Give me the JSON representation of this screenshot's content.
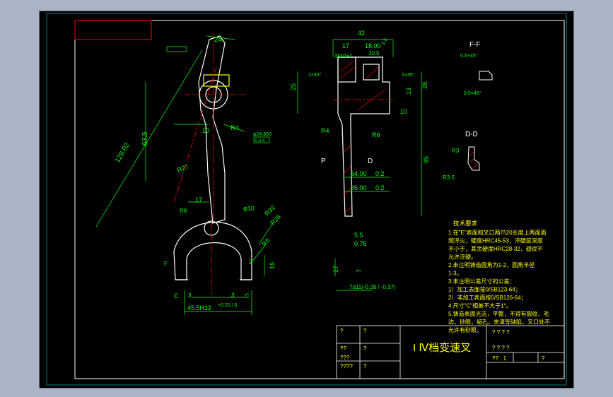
{
  "title_block": {
    "part_name": "I Ⅳ档变速叉",
    "scale_text": "? ? ? ?",
    "sheet_text": "?? : 1",
    "q": "?",
    "q2": "??",
    "q3": "???",
    "q4": "????"
  },
  "tech_req": {
    "heading": "技术要求",
    "lines": [
      "1.在\"E\"表面和叉口两爪20长度上两面面",
      "频淬火，硬度HRC45-53，淬硬层深度",
      "不小于，其余硬度HRC28-32，翅纹不",
      "允许淬硬。",
      "2.未注明铸造圆角为1-2，圆角半径",
      "1-3。",
      "3.未注明公差尺寸的公差：",
      "  1）加工表面按0/SB123-64；",
      "  2）非加工表面按0/SB126-64；",
      "4.尺寸\"C\"相差不大于1°。",
      "5.铸造表面光洁，平整，不得有裂纹，毛",
      "  边，砂眼，缩孔，夹渣等缺陷，叉口处不",
      "  允许有砂眼。"
    ]
  },
  "section_labels": {
    "ff": "F-F",
    "dd": "D-D",
    "p": "P",
    "d": "D"
  },
  "dims_left": {
    "d24": "24",
    "d128": "128.02",
    "d63": "63.5",
    "d10a": "10",
    "d17": "17",
    "r4": "R4",
    "r27": "R27",
    "phi10": "φ10",
    "r32": "R32",
    "r26": "R26",
    "r6": "R6",
    "d16": "16",
    "d2": "2",
    "c1": "C",
    "c2": "C",
    "d3a": "3",
    "d3b": "3",
    "d45": "45.5H12",
    "tol": "+0.25 / 0",
    "phi24": "φ24.800",
    "box": "0.4 A",
    "r8": "R8",
    "f": "F"
  },
  "dims_right": {
    "d42": "42",
    "d17": "17",
    "d1800": "18.00",
    "d105": "10.5",
    "d15": "1.5",
    "m10": "M10×1",
    "d25": "25",
    "d13": "13",
    "d28": "28",
    "d10": "10",
    "d95": "95",
    "d34": "34.00",
    "d02a": "0.2",
    "d35": "35.00",
    "d02b": "0.2",
    "d55": "5.5",
    "d075": "0.75",
    "d27": "27",
    "d7": "7",
    "tol7": "7d11(-0.28 / -0.37)",
    "r4": "R4",
    "r6": "R6",
    "ch1": "1×45°",
    "ch2": "1×45°",
    "r3": "R3",
    "r35": "R3.5",
    "ff1": "0.5×45°",
    "ff2": "0.5×45°"
  }
}
